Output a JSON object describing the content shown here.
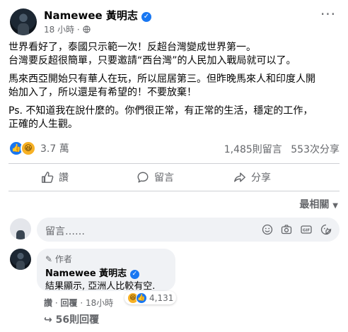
{
  "post": {
    "author": "Namewee 黃明志",
    "time": "18 小時",
    "globe_icon": "globe-icon",
    "more_icon": "more-dots-icon",
    "lines": [
      "世界看好了，泰國只示範一次！反超台灣變成世界第一。",
      "台灣要反超很簡單，只要邀請“西台灣”的人民加入戰局就可以了。",
      "馬來西亞開始只有華人在玩，所以屈居第三。但昨晚馬來人和印度人開",
      "始加入了，所以還是有希望的！不要放棄！",
      "Ps. 不知道我在說什麼的。你們很正常，有正常的生活，穩定的工作，",
      "正確的人生觀。"
    ],
    "reactions_count": "3.7 萬",
    "comments_count": "1,485則留言",
    "shares_count": "553次分享"
  },
  "actions": {
    "like": "讚",
    "comment": "留言",
    "share": "分享"
  },
  "sort": {
    "label": "最相關"
  },
  "composer": {
    "placeholder": "留言……"
  },
  "comment": {
    "badge": "作者",
    "author": "Namewee 黃明志",
    "text": "結果顯示, 亞洲人比較有空.",
    "reaction_count": "4,131",
    "like_link": "讚",
    "reply_link": "回覆",
    "time": "18小時",
    "replies": "56則回覆"
  },
  "colors": {
    "accent": "#1877f2",
    "secondary_text": "#65676b",
    "bubble": "#f0f2f5"
  }
}
